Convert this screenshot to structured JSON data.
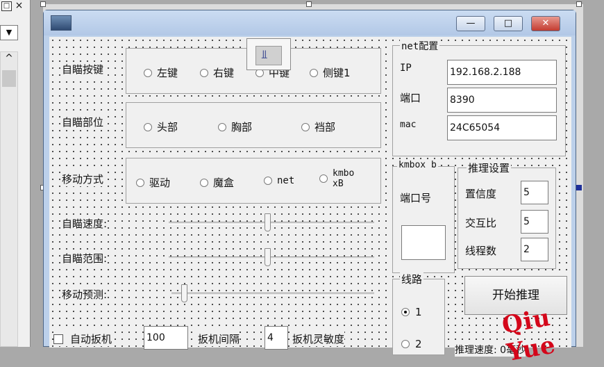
{
  "ide": {
    "close_glyph": "×",
    "restore_glyph": "□",
    "dropdown_glyph": "▼",
    "scroll_up_glyph": "^"
  },
  "window": {
    "minimize_glyph": "—",
    "maximize_glyph": "□",
    "close_glyph": "✕"
  },
  "aim_key": {
    "label": "自瞄按键",
    "options": [
      "左键",
      "右键",
      "中键",
      "侧键1"
    ]
  },
  "aim_part": {
    "label": "自瞄部位",
    "options": [
      "头部",
      "胸部",
      "裆部"
    ]
  },
  "move_mode": {
    "label": "移动方式",
    "options": [
      "驱动",
      "魔盒",
      "net"
    ],
    "kmbox_line1": "kmbo",
    "kmbox_line2": "xB"
  },
  "aim_speed": {
    "label": "自瞄速度:",
    "value": 0.48
  },
  "aim_range": {
    "label": "自瞄范围:",
    "value": 0.48
  },
  "move_predict": {
    "label": "移动预测:",
    "value": 0.05
  },
  "net_config": {
    "title": "net配置",
    "ip_label": "IP",
    "ip_value": "192.168.2.188",
    "port_label": "端口",
    "port_value": "8390",
    "mac_label": "mac",
    "mac_value": "24C65054"
  },
  "kmbox": {
    "title": "kmbox b",
    "port_label": "端口号",
    "port_value": ""
  },
  "inference": {
    "title": "推理设置",
    "confidence_label": "置信度",
    "confidence_value": "5",
    "iou_label": "交互比",
    "iou_value": "5",
    "threads_label": "线程数",
    "threads_value": "2"
  },
  "line": {
    "title": "线路",
    "options": [
      "1",
      "2"
    ],
    "selected": "1"
  },
  "start_button": {
    "label": "开始推理"
  },
  "trigger": {
    "auto_label": "自动扳机",
    "interval_value": "100",
    "interval_label": "扳机间隔",
    "sensitivity_value": "4",
    "sensitivity_label": "扳机灵敏度"
  },
  "status": {
    "speed_label": "推理速度: 0毫秒"
  },
  "watermark": "Qiu Yue",
  "colors": {
    "watermark": "#d4061a",
    "titlebar": "#bcd0ea",
    "close_button": "#c9463d"
  }
}
